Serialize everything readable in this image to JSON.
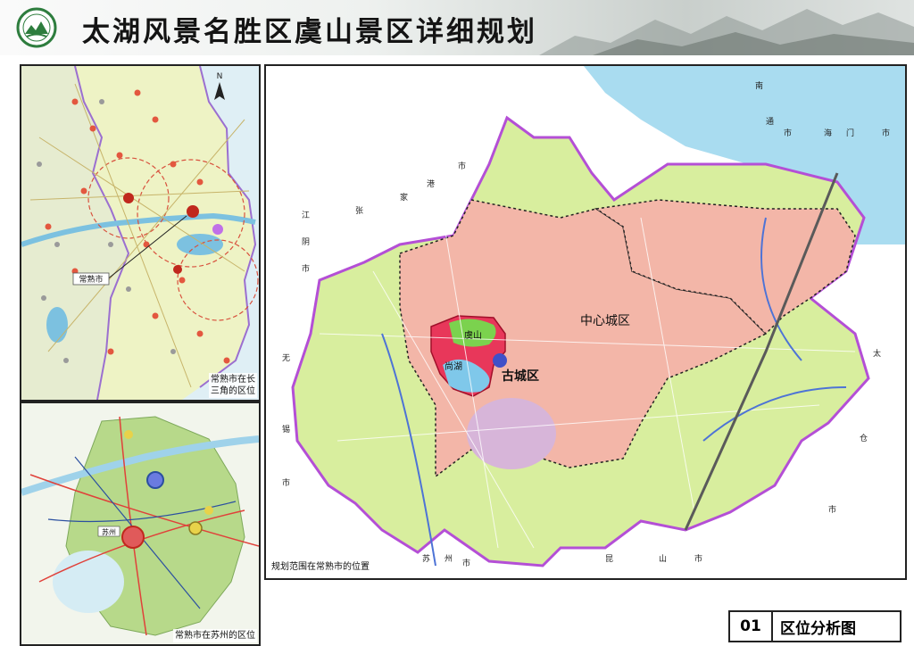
{
  "header": {
    "title": "太湖风景名胜区虞山景区详细规划"
  },
  "top_left_map": {
    "caption_line1": "常熟市在长",
    "caption_line2": "三角的区位",
    "callout_label": "常熟市",
    "north_symbol": "N"
  },
  "bottom_left_map": {
    "caption": "常熟市在苏州的区位",
    "city_label": "苏州"
  },
  "main_map": {
    "caption": "规划范围在常熟市的位置",
    "zone_central": "中心城区",
    "zone_old_town": "古城区",
    "mountain": "虞山",
    "lake": "尚湖",
    "border_chars": [
      "江",
      "阴",
      "市",
      "张",
      "家",
      "港",
      "市",
      "南",
      "通",
      "市",
      "海",
      "门",
      "市",
      "太",
      "仓",
      "市",
      "昆",
      "山",
      "市",
      "苏",
      "州",
      "市",
      "无",
      "锡",
      "市"
    ]
  },
  "footer": {
    "number": "01",
    "title": "区位分析图"
  },
  "colors": {
    "boundary": "#b44fd6",
    "central_zone": "#f3b6a8",
    "suburb": "#d8ee9e",
    "old_town": "#e8375a",
    "water": "#9fd8ee",
    "mountain": "#7bd24e"
  }
}
